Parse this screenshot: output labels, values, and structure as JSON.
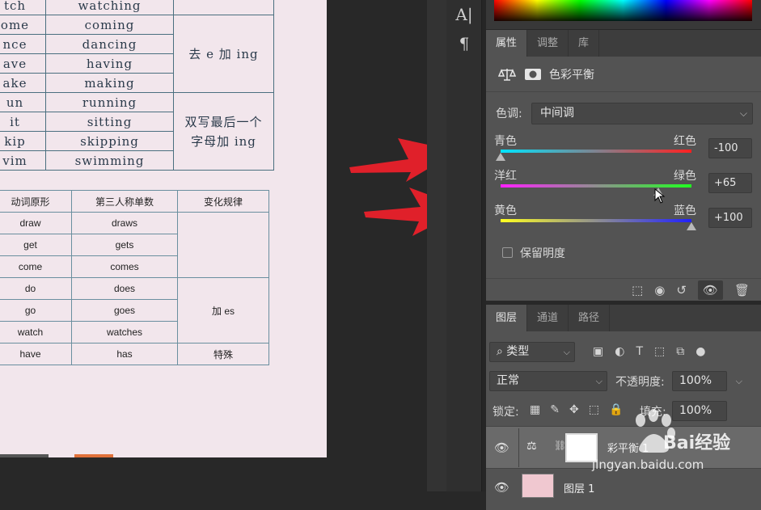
{
  "doc": {
    "table1": {
      "rows": [
        [
          "tch",
          "watching",
          ""
        ],
        [
          "ome",
          "coming",
          ""
        ],
        [
          "nce",
          "dancing",
          ""
        ],
        [
          "ave",
          "having",
          ""
        ],
        [
          "ake",
          "making",
          ""
        ],
        [
          "un",
          "running",
          ""
        ],
        [
          "it",
          "sitting",
          ""
        ],
        [
          "kip",
          "skipping",
          ""
        ],
        [
          "vim",
          "swimming",
          ""
        ]
      ],
      "rule_e": "去 e 加 ing",
      "rule_double": "双写最后一个字母加 ing"
    },
    "table2": {
      "headers": [
        "动词原形",
        "第三人称单数",
        "变化规律"
      ],
      "rows": [
        [
          "draw",
          "draws"
        ],
        [
          "get",
          "gets"
        ],
        [
          "come",
          "comes"
        ],
        [
          "do",
          "does"
        ],
        [
          "go",
          "goes"
        ],
        [
          "watch",
          "watches"
        ],
        [
          "have",
          "has"
        ]
      ],
      "rule_es": "加 es",
      "rule_special": "特殊"
    }
  },
  "tools": {
    "text_tool": "A|",
    "paragraph": "¶"
  },
  "properties": {
    "tabs": [
      "属性",
      "调整",
      "库"
    ],
    "adjustment_title": "色彩平衡",
    "tone_label": "色调:",
    "tone_value": "中间调",
    "sliders": [
      {
        "left": "青色",
        "right": "红色",
        "value": "-100",
        "level": -100
      },
      {
        "left": "洋红",
        "right": "绿色",
        "value": "+65",
        "level": 65
      },
      {
        "left": "黄色",
        "right": "蓝色",
        "value": "+100",
        "level": 100
      }
    ],
    "preserve_luminosity": "保留明度"
  },
  "layers": {
    "tabs": [
      "图层",
      "通道",
      "路径"
    ],
    "filter_type": "类型",
    "blend_mode": "正常",
    "opacity_label": "不透明度:",
    "opacity_value": "100%",
    "lock_label": "锁定:",
    "fill_label": "填充:",
    "fill_value": "100%",
    "items": [
      {
        "name": "彩平衡 1"
      },
      {
        "name": "图层 1"
      }
    ]
  },
  "watermark": {
    "brand": "Bai经验",
    "url": "jingyan.baidu.com"
  },
  "colors": {
    "arrow": "#e0202a",
    "panel": "#535353"
  }
}
